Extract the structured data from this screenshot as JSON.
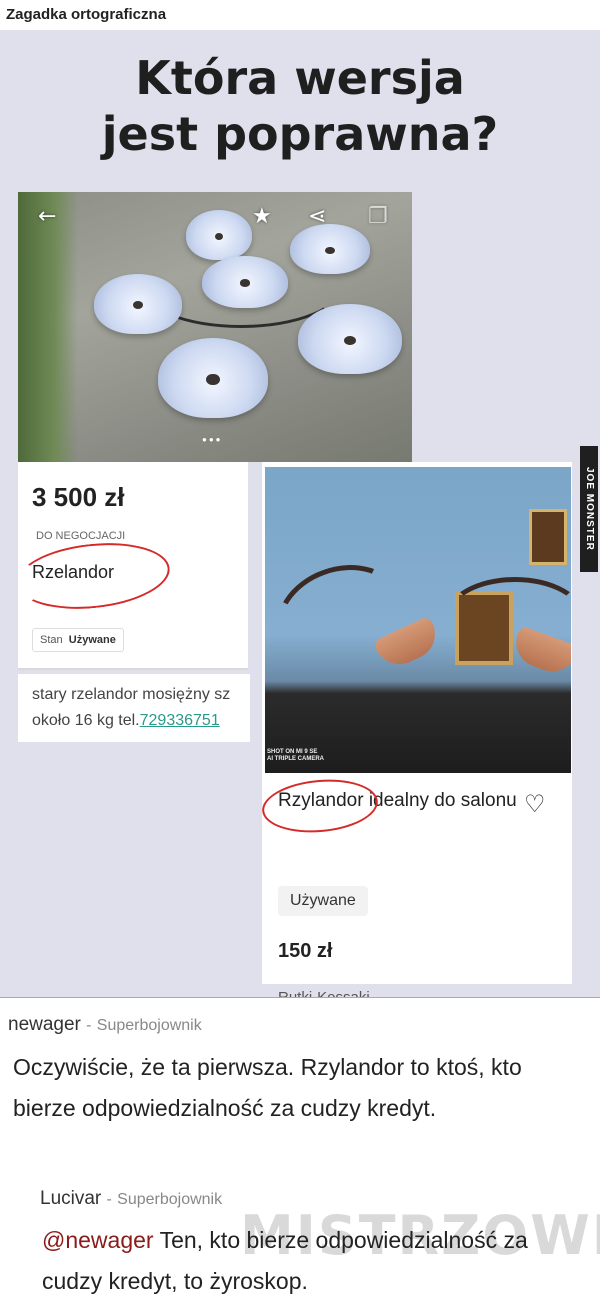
{
  "page": {
    "section_title": "Zagadka ortograficzna"
  },
  "meme": {
    "title_line1": "Która wersja",
    "title_line2": "jest poprawna?",
    "listing1": {
      "price": "3 500 zł",
      "negotiation": "DO NEGOCJACJI",
      "model": "Rzelandor",
      "state_label": "Stan",
      "state_value": "Używane",
      "desc_line1": "stary rzelandor mosiężny sz",
      "desc_line2_prefix": "około 16 kg tel.",
      "phone": "729336751"
    },
    "listing2": {
      "camera_line1": "SHOT ON MI 9 SE",
      "camera_line2": "AI TRIPLE CAMERA",
      "title": "Rzylandor idealny do salonu",
      "state": "Używane",
      "price": "150 zł",
      "location": "Rutki-Kossaki"
    },
    "watermark_side": "JOE MONSTER",
    "icons": [
      "back-arrow-icon",
      "star-icon",
      "share-icon",
      "copy-icon",
      "heart-icon"
    ]
  },
  "comments": [
    {
      "author": "newager",
      "rank": "Superbojownik",
      "text": "Oczywiście, że ta pierwsza. Rzylandor to ktoś, kto bierze odpowiedzialność za cudzy kredyt."
    },
    {
      "author": "Lucivar",
      "rank": "Superbojownik",
      "mention": "@newager",
      "text": "Ten, kto bierze odpowiedzialność za cudzy kredyt, to żyroskop."
    }
  ],
  "site_watermark": "MISTRZOWIE",
  "colors": {
    "meme_bg": "#dfe0ec",
    "annotation_red": "#d42a2a",
    "phone_link": "#2a9a8a",
    "mention": "#8b1a1a"
  }
}
